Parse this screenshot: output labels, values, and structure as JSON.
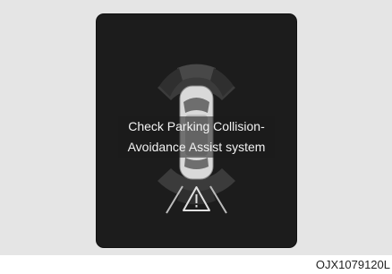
{
  "display": {
    "message_line1": "Check Parking Collision-",
    "message_line2": "Avoidance Assist system",
    "vehicle_icon": "car-top-view-icon",
    "sensor_zone_icon": "sensor-arc-icon",
    "warning_icon": "warning-triangle-icon"
  },
  "caption": "OJX1079120L",
  "colors": {
    "screen_background": "#1c1c1c",
    "panel_background": "#e5e5e5",
    "text": "#f2f2f2"
  }
}
